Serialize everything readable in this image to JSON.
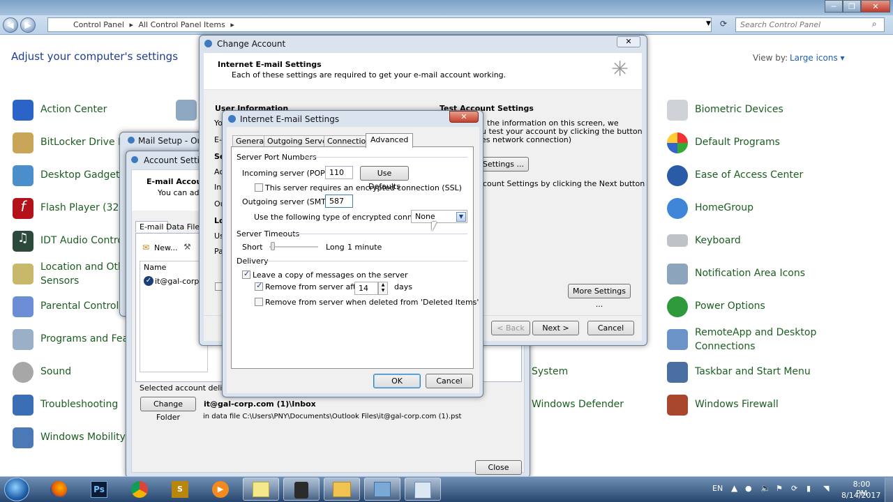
{
  "control_panel": {
    "breadcrumb": [
      "Control Panel",
      "All Control Panel Items"
    ],
    "search_placeholder": "Search Control Panel",
    "heading": "Adjust your computer's settings",
    "view_by_label": "View by:",
    "view_by_value": "Large icons",
    "left_items": [
      "Action Center",
      "BitLocker Drive En",
      "Desktop Gadgets",
      "Flash Player (32-b",
      "IDT Audio Control",
      "Location and Othe",
      "Sensors",
      "Parental Controls",
      "Programs and Feat",
      "Sound",
      "Troubleshooting",
      "Windows Mobility"
    ],
    "middle_items": [
      "System",
      "Windows Defender"
    ],
    "right_items": [
      "Biometric Devices",
      "Default Programs",
      "Ease of Access Center",
      "HomeGroup",
      "Keyboard",
      "Notification Area Icons",
      "Power Options",
      "RemoteApp and Desktop",
      "Connections",
      "Taskbar and Start Menu",
      "Windows Firewall"
    ]
  },
  "mail_setup": {
    "title": "Mail Setup - Outl"
  },
  "account_settings": {
    "title": "Account Setting",
    "header": "E-mail Accoun",
    "sub": "You can add",
    "tabs": [
      "E-mail",
      "Data Files"
    ],
    "toolbar_new": "New...",
    "col_name": "Name",
    "account": "it@gal-corp.c",
    "deliver_label": "Selected account delivers",
    "change_folder": "Change Folder",
    "folder_path": "it@gal-corp.com (1)\\Inbox",
    "data_file": "in data file C:\\Users\\PNY\\Documents\\Outlook Files\\it@gal-corp.com (1).pst",
    "close": "Close"
  },
  "change_account": {
    "title": "Change Account",
    "header": "Internet E-mail Settings",
    "sub": "Each of these settings are required to get your e-mail account working.",
    "user_info": "User Information",
    "test_header": "Test Account Settings",
    "test_line1": "the information on this screen, we",
    "test_line2": "u test your account by clicking the button",
    "test_line3": "es network connection)",
    "test_btn": "t Settings ...",
    "test_line4": "count Settings by clicking the Next button",
    "left_frags": [
      "Yo",
      "E-",
      "Se",
      "Ac",
      "In",
      "Ou",
      "Lo",
      "Us",
      "Pa"
    ],
    "more_settings": "More Settings ...",
    "back": "< Back",
    "next": "Next >",
    "cancel": "Cancel"
  },
  "dialog": {
    "title": "Internet E-mail Settings",
    "tabs": [
      "General",
      "Outgoing Server",
      "Connection",
      "Advanced"
    ],
    "port_header": "Server Port Numbers",
    "incoming_label": "Incoming server (POP3):",
    "incoming_value": "110",
    "use_defaults": "Use Defaults",
    "ssl_label": "This server requires an encrypted connection (SSL)",
    "outgoing_label": "Outgoing server (SMTP):",
    "outgoing_value": "587",
    "enc_label": "Use the following type of encrypted connection:",
    "enc_value": "None",
    "timeouts_header": "Server Timeouts",
    "short": "Short",
    "long": "Long",
    "timeout_value": "1 minute",
    "delivery_header": "Delivery",
    "leave_copy": "Leave a copy of messages on the server",
    "remove_after": "Remove from server after",
    "days_value": "14",
    "days": "days",
    "remove_deleted": "Remove from server when deleted from 'Deleted Items'",
    "ok": "OK",
    "cancel": "Cancel"
  },
  "tray": {
    "lang": "EN",
    "time": "8:00 PM",
    "date": "8/14/2017"
  }
}
